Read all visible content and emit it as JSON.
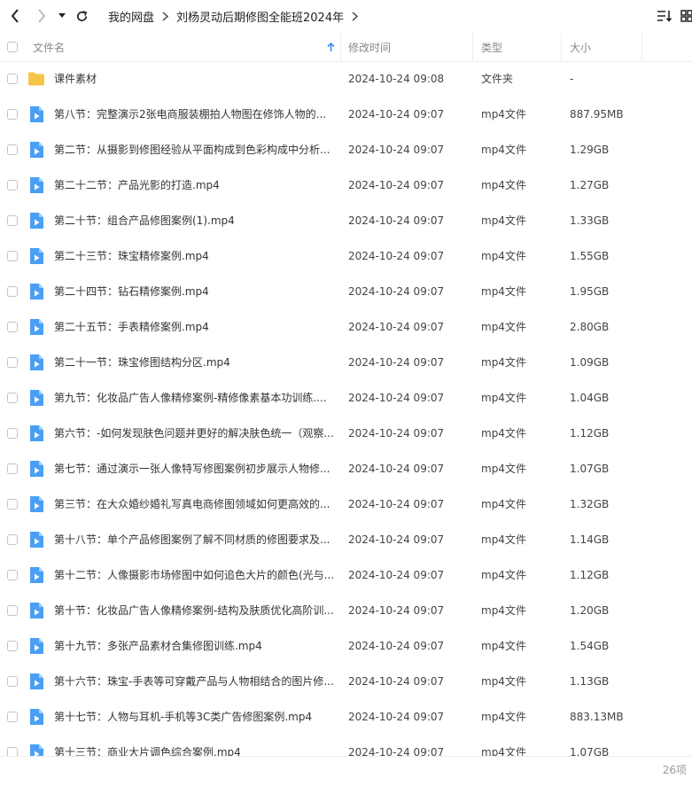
{
  "toolbar": {
    "breadcrumbs": [
      "我的网盘",
      "刘杨灵动后期修图全能班2024年"
    ]
  },
  "columns": {
    "name": "文件名",
    "modified": "修改时间",
    "type": "类型",
    "size": "大小"
  },
  "files": [
    {
      "name": "课件素材",
      "modified": "2024-10-24 09:08",
      "type": "文件夹",
      "size": "-",
      "icon": "folder-icon"
    },
    {
      "name": "第八节：完整演示2张电商服装棚拍人物图在修饰人物的...",
      "modified": "2024-10-24 09:07",
      "type": "mp4文件",
      "size": "887.95MB",
      "icon": "video-file-icon"
    },
    {
      "name": "第二节：从摄影到修图经验从平面构成到色彩构成中分析...",
      "modified": "2024-10-24 09:07",
      "type": "mp4文件",
      "size": "1.29GB",
      "icon": "video-file-icon"
    },
    {
      "name": "第二十二节：产品光影的打造.mp4",
      "modified": "2024-10-24 09:07",
      "type": "mp4文件",
      "size": "1.27GB",
      "icon": "video-file-icon"
    },
    {
      "name": "第二十节：组合产品修图案例(1).mp4",
      "modified": "2024-10-24 09:07",
      "type": "mp4文件",
      "size": "1.33GB",
      "icon": "video-file-icon"
    },
    {
      "name": "第二十三节：珠宝精修案例.mp4",
      "modified": "2024-10-24 09:07",
      "type": "mp4文件",
      "size": "1.55GB",
      "icon": "video-file-icon"
    },
    {
      "name": "第二十四节：钻石精修案例.mp4",
      "modified": "2024-10-24 09:07",
      "type": "mp4文件",
      "size": "1.95GB",
      "icon": "video-file-icon"
    },
    {
      "name": "第二十五节：手表精修案例.mp4",
      "modified": "2024-10-24 09:07",
      "type": "mp4文件",
      "size": "2.80GB",
      "icon": "video-file-icon"
    },
    {
      "name": "第二十一节：珠宝修图结构分区.mp4",
      "modified": "2024-10-24 09:07",
      "type": "mp4文件",
      "size": "1.09GB",
      "icon": "video-file-icon"
    },
    {
      "name": "第九节：化妆品广告人像精修案例-精修像素基本功训练....",
      "modified": "2024-10-24 09:07",
      "type": "mp4文件",
      "size": "1.04GB",
      "icon": "video-file-icon"
    },
    {
      "name": "第六节：-如何发现肤色问题并更好的解决肤色统一（观察...",
      "modified": "2024-10-24 09:07",
      "type": "mp4文件",
      "size": "1.12GB",
      "icon": "video-file-icon"
    },
    {
      "name": "第七节：通过演示一张人像特写修图案例初步展示人物修...",
      "modified": "2024-10-24 09:07",
      "type": "mp4文件",
      "size": "1.07GB",
      "icon": "video-file-icon"
    },
    {
      "name": "第三节：在大众婚纱婚礼写真电商修图领域如何更高效的...",
      "modified": "2024-10-24 09:07",
      "type": "mp4文件",
      "size": "1.32GB",
      "icon": "video-file-icon"
    },
    {
      "name": "第十八节：单个产品修图案例了解不同材质的修图要求及...",
      "modified": "2024-10-24 09:07",
      "type": "mp4文件",
      "size": "1.14GB",
      "icon": "video-file-icon"
    },
    {
      "name": "第十二节：人像摄影市场修图中如何追色大片的颜色(光与...",
      "modified": "2024-10-24 09:07",
      "type": "mp4文件",
      "size": "1.12GB",
      "icon": "video-file-icon"
    },
    {
      "name": "第十节：化妆品广告人像精修案例-结构及肤质优化高阶训...",
      "modified": "2024-10-24 09:07",
      "type": "mp4文件",
      "size": "1.20GB",
      "icon": "video-file-icon"
    },
    {
      "name": "第十九节：多张产品素材合集修图训练.mp4",
      "modified": "2024-10-24 09:07",
      "type": "mp4文件",
      "size": "1.54GB",
      "icon": "video-file-icon"
    },
    {
      "name": "第十六节：珠宝-手表等可穿戴产品与人物相结合的图片修...",
      "modified": "2024-10-24 09:07",
      "type": "mp4文件",
      "size": "1.13GB",
      "icon": "video-file-icon"
    },
    {
      "name": "第十七节：人物与耳机-手机等3C类广告修图案例.mp4",
      "modified": "2024-10-24 09:07",
      "type": "mp4文件",
      "size": "883.13MB",
      "icon": "video-file-icon"
    },
    {
      "name": "第十三节：商业大片调色综合案例.mp4",
      "modified": "2024-10-24 09:07",
      "type": "mp4文件",
      "size": "1.07GB",
      "icon": "video-file-icon"
    }
  ],
  "footer": {
    "count": "26项"
  },
  "colors": {
    "video_icon": "#4a9ff5",
    "folder_icon": "#f7c44a",
    "sort_arrow": "#3b8cf0"
  }
}
